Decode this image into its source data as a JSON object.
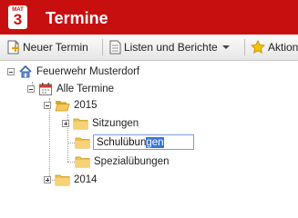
{
  "app": {
    "logo_caption": "MAT",
    "logo_number": "3",
    "title": "Termine"
  },
  "toolbar": {
    "new_label": "Neuer Termin",
    "lists_label": "Listen und Berichte",
    "actions_label": "Aktionen"
  },
  "tree": {
    "root_label": "Feuerwehr Musterdorf",
    "all_label": "Alle Termine",
    "year_2015": "2015",
    "folder_sitzungen": "Sitzungen",
    "folder_spezial": "Spezialübungen",
    "year_2014": "2014"
  },
  "editor": {
    "value_before_selection": "Schulübun",
    "selected_text": "gen"
  },
  "colors": {
    "header": "#c80f10",
    "selection": "#3875d7",
    "folder": "#f2c14e"
  }
}
